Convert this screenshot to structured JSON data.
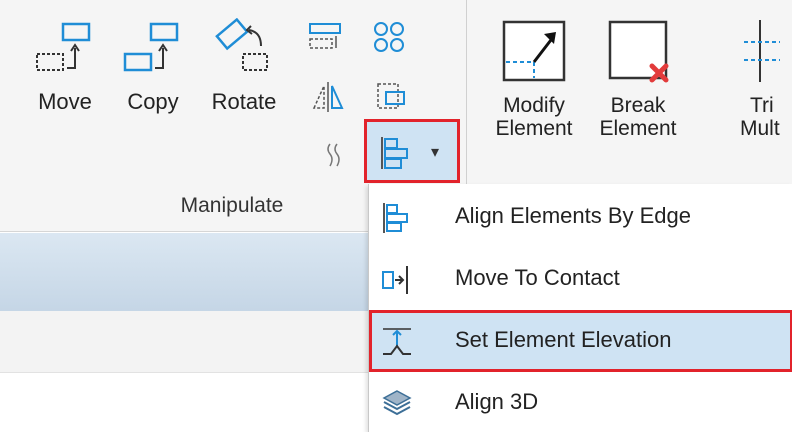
{
  "ribbon": {
    "manipulate": {
      "group_label": "Manipulate",
      "buttons": [
        {
          "label": "Move",
          "icon": "move-icon"
        },
        {
          "label": "Copy",
          "icon": "copy-icon"
        },
        {
          "label": "Rotate",
          "icon": "rotate-icon"
        }
      ],
      "small_icons": [
        "array-icon",
        "mirror-icon",
        "group-icon",
        "offset-icon",
        "spring-icon"
      ],
      "align_dropdown": {
        "icon": "align-edge-icon",
        "arrow": "▾",
        "selected": true
      }
    },
    "modify": {
      "buttons": [
        {
          "line1": "Modify",
          "line2": "Element",
          "icon": "modify-element-icon"
        },
        {
          "line1": "Break",
          "line2": "Element",
          "icon": "break-element-icon"
        },
        {
          "line1": "Tri",
          "line2": "Mult",
          "icon": "trim-multiple-icon"
        }
      ]
    }
  },
  "dropdown_menu": {
    "items": [
      {
        "label": "Align Elements By Edge",
        "icon": "align-edge-icon",
        "selected": false
      },
      {
        "label": "Move To Contact",
        "icon": "move-to-contact-icon",
        "selected": false
      },
      {
        "label": "Set Element Elevation",
        "icon": "set-elevation-icon",
        "selected": true
      },
      {
        "label": "Align 3D",
        "icon": "align-3d-icon",
        "selected": false
      }
    ]
  },
  "colors": {
    "highlight_border": "#e2232b",
    "selected_fill": "#cfe3f3",
    "icon_blue": "#1f8dd6"
  }
}
